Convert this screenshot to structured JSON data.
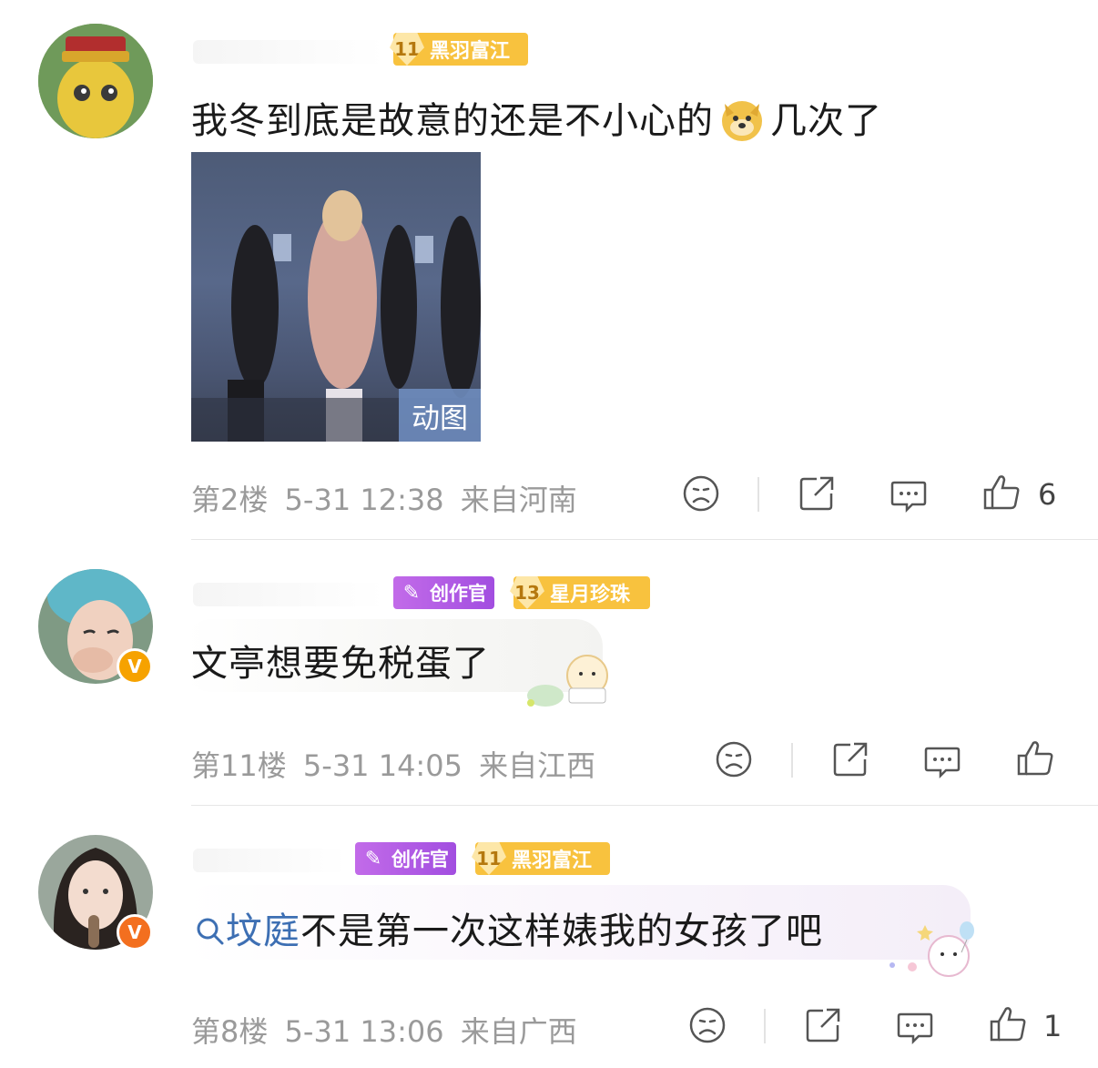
{
  "comments": [
    {
      "level_badge": {
        "level": "11",
        "title": "黑羽富江"
      },
      "text_before_emoji": "我冬到底是故意的还是不小心的",
      "emoji": "doge-emoji",
      "text_after_emoji": "几次了",
      "gif_label": "动图",
      "floor": "第2楼",
      "date": "5-31 12:38",
      "location": "来自河南",
      "like_count": "6"
    },
    {
      "creator_badge": "创作官",
      "level_badge": {
        "level": "13",
        "title": "星月珍珠"
      },
      "text": "文亭想要免税蛋了",
      "floor": "第11楼",
      "date": "5-31 14:05",
      "location": "来自江西",
      "like_count": ""
    },
    {
      "creator_badge": "创作官",
      "level_badge": {
        "level": "11",
        "title": "黑羽富江"
      },
      "link_text": "坟庭",
      "text": "不是第一次这样婊我的女孩了吧",
      "floor": "第8楼",
      "date": "5-31 13:06",
      "location": "来自广西",
      "like_count": "1"
    }
  ],
  "verified_mark": "V",
  "colors": {
    "level_badge": "#f8c23e",
    "creator_badge": "#a24ee0",
    "meta_text": "#9a9a9a",
    "link": "#3d6fb3",
    "verified": "#f6a200"
  }
}
